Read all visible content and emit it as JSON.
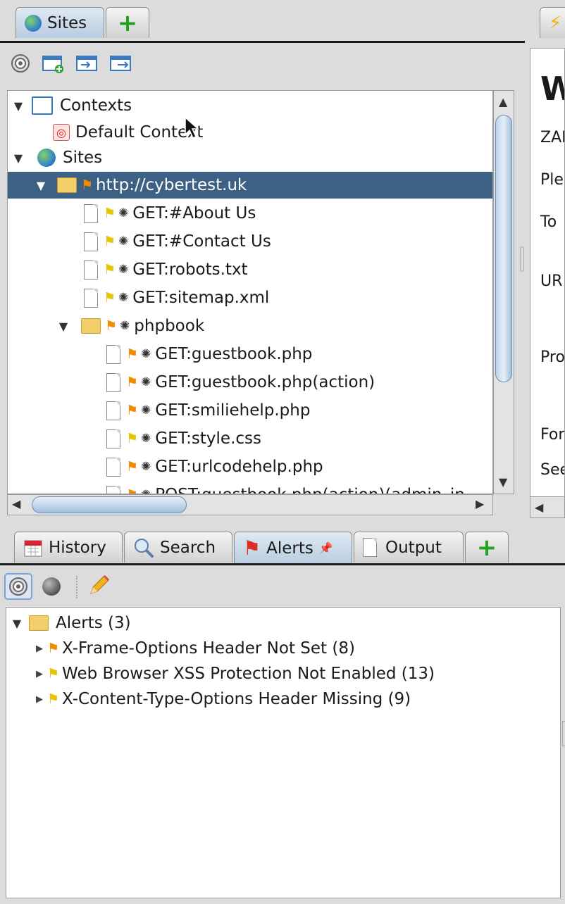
{
  "top_tabs": [
    {
      "label": "Sites",
      "icon": "globe-icon"
    },
    {
      "label": "",
      "icon": "plus-icon"
    }
  ],
  "sites_toolbar": [
    "target-icon",
    "new-context-icon",
    "import-context-icon",
    "export-context-icon"
  ],
  "tree": {
    "contexts_label": "Contexts",
    "default_context_label": "Default Context",
    "sites_label": "Sites",
    "host": "http://cybertest.uk",
    "items": [
      "GET:#About Us",
      "GET:#Contact Us",
      "GET:robots.txt",
      "GET:sitemap.xml"
    ],
    "folder": "phpbook",
    "sub_items": [
      "GET:guestbook.php",
      "GET:guestbook.php(action)",
      "GET:smiliehelp.php",
      "GET:style.css",
      "GET:urlcodehelp.php",
      "POST:guestbook.php(action)(admin_in"
    ]
  },
  "right_panel": {
    "heading": "W",
    "lines": [
      "ZAI",
      "Ple",
      "To",
      "UR",
      "Pro",
      "For",
      "See"
    ]
  },
  "bottom_tabs": [
    "History",
    "Search",
    "Alerts",
    "Output"
  ],
  "alerts": {
    "root": "Alerts (3)",
    "items": [
      {
        "label": "X-Frame-Options Header Not Set (8)",
        "risk_color": "#f08c00"
      },
      {
        "label": "Web Browser XSS Protection Not Enabled (13)",
        "risk_color": "#e8c400"
      },
      {
        "label": "X-Content-Type-Options Header Missing (9)",
        "risk_color": "#e8c400"
      }
    ]
  }
}
